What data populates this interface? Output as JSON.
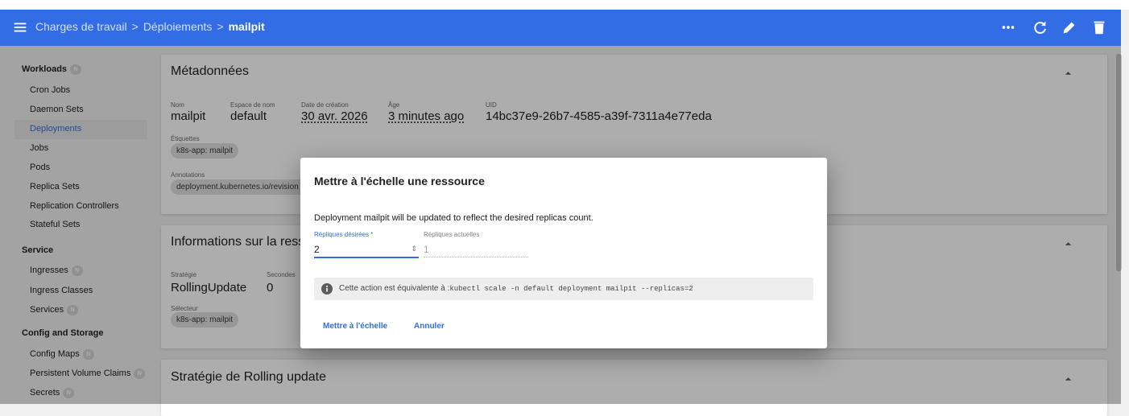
{
  "toolbar": {
    "breadcrumb": [
      "Charges de travail",
      "Déploiements",
      "mailpit"
    ],
    "actions": [
      "more-icon",
      "refresh-icon",
      "edit-icon",
      "delete-icon"
    ]
  },
  "sidebar": {
    "sections": [
      {
        "title": "Workloads",
        "badge": "N",
        "items": [
          {
            "label": "Cron Jobs"
          },
          {
            "label": "Daemon Sets"
          },
          {
            "label": "Deployments",
            "active": true
          },
          {
            "label": "Jobs"
          },
          {
            "label": "Pods"
          },
          {
            "label": "Replica Sets"
          },
          {
            "label": "Replication Controllers"
          },
          {
            "label": "Stateful Sets"
          }
        ]
      },
      {
        "title": "Service",
        "items": [
          {
            "label": "Ingresses",
            "badge": "N"
          },
          {
            "label": "Ingress Classes"
          },
          {
            "label": "Services",
            "badge": "N"
          }
        ]
      },
      {
        "title": "Config and Storage",
        "items": [
          {
            "label": "Config Maps",
            "badge": "N"
          },
          {
            "label": "Persistent Volume Claims",
            "badge": "N"
          },
          {
            "label": "Secrets",
            "badge": "N"
          }
        ]
      }
    ]
  },
  "metadata": {
    "title": "Métadonnées",
    "fields": {
      "name_label": "Nom",
      "name": "mailpit",
      "namespace_label": "Espace de nom",
      "namespace": "default",
      "created_label": "Date de création",
      "created": "30 avr. 2026",
      "age_label": "Âge",
      "age": "3 minutes ago",
      "uid_label": "UID",
      "uid": "14bc37e9-26b7-4585-a39f-7311a4e77eda"
    },
    "labels_label": "Étiquettes",
    "labels": [
      "k8s-app: mailpit"
    ],
    "annotations_label": "Annotations",
    "annotations": [
      "deployment.kubernetes.io/revision"
    ]
  },
  "resource_info": {
    "title": "Informations sur la resso",
    "strategy_label": "Stratégie",
    "strategy": "RollingUpdate",
    "seconds_label": "Secondes",
    "seconds": "0",
    "selector_label": "Sélecteur",
    "selector": [
      "k8s-app: mailpit"
    ]
  },
  "rolling_update": {
    "title": "Stratégie de Rolling update"
  },
  "dialog": {
    "title": "Mettre à l'échelle une ressource",
    "description": "Deployment mailpit will be updated to reflect the desired replicas count.",
    "desired_label": "Répliques désirées *",
    "desired_value": "2",
    "desired_spinner": "⇕",
    "current_label": "Répliques actuelles",
    "current_value": "1",
    "info_prefix": "Cette action est équivalente à :",
    "info_command": "kubectl scale -n default deployment mailpit --replicas=2",
    "confirm": "Mettre à l'échelle",
    "cancel": "Annuler"
  },
  "colors": {
    "primary": "#326de6",
    "overlay": "rgba(0,0,0,0.32)"
  }
}
